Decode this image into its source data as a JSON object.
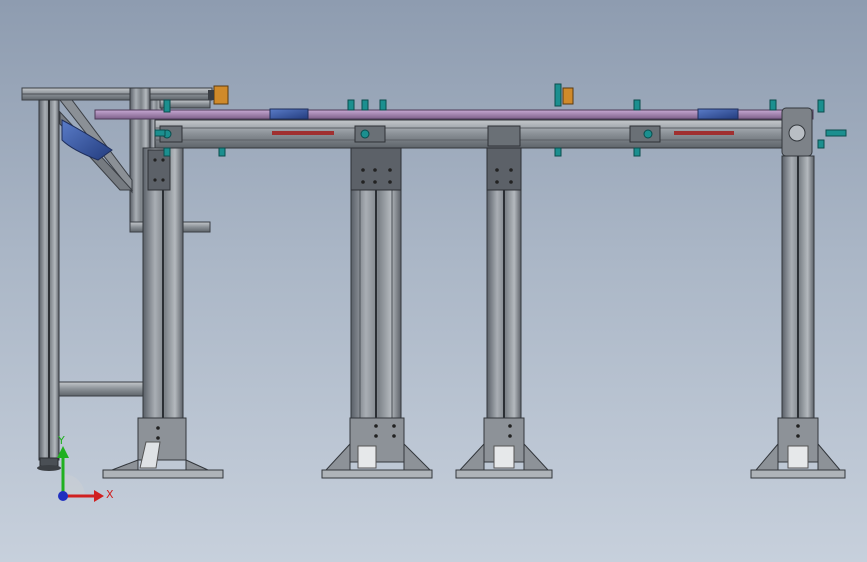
{
  "viewport": {
    "background_top": "#8e9cb0",
    "background_bottom": "#c7d0dc"
  },
  "colors": {
    "frame_steel": "#6e747b",
    "frame_dark": "#3a3e44",
    "frame_light": "#b9bec4",
    "chain_rail": "#9b7fa8",
    "fitting_teal": "#1b8f8f",
    "bracket_blue": "#3457a8",
    "sensor_orange": "#d08a2a",
    "hazard_red": "#a03030"
  },
  "triad": {
    "y_label": "Y",
    "x_label": "X",
    "x_color": "#d02020",
    "y_color": "#20b020",
    "origin_color": "#2030c0"
  },
  "model": {
    "name": "conveyor-assembly",
    "supports": [
      "support-leg-1",
      "support-leg-2",
      "support-leg-3",
      "support-leg-4"
    ]
  }
}
